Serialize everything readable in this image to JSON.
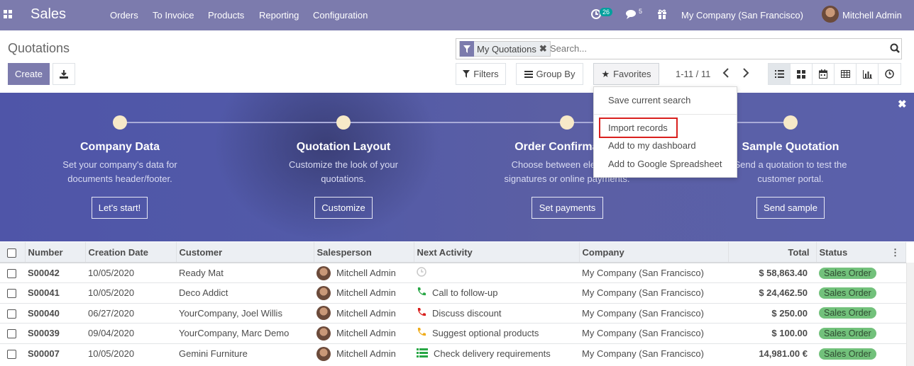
{
  "app": {
    "title": "Sales",
    "menu": [
      "Orders",
      "To Invoice",
      "Products",
      "Reporting",
      "Configuration"
    ],
    "activity_count": "26",
    "message_count": "5",
    "company": "My Company (San Francisco)",
    "user": "Mitchell Admin"
  },
  "control": {
    "breadcrumb": "Quotations",
    "create_label": "Create",
    "facet_label": "My Quotations",
    "search_placeholder": "Search...",
    "filters_label": "Filters",
    "groupby_label": "Group By",
    "favorites_label": "Favorites",
    "pager": "1-11 / 11"
  },
  "favorites_menu": {
    "items": [
      "Save current search",
      "Import records",
      "Add to my dashboard",
      "Add to Google Spreadsheet"
    ],
    "highlighted": "Import records",
    "highlight_color": "#d9201e"
  },
  "onboarding": {
    "steps": [
      {
        "title": "Company Data",
        "desc1": "Set your company's data for",
        "desc2": "documents header/footer.",
        "button": "Let's start!"
      },
      {
        "title": "Quotation Layout",
        "desc1": "Customize the look of your",
        "desc2": "quotations.",
        "button": "Customize"
      },
      {
        "title": "Order Confirmation",
        "desc1": "Choose between electronic",
        "desc2": "signatures or online payments.",
        "button": "Set payments"
      },
      {
        "title": "Sample Quotation",
        "desc1": "Send a quotation to test the",
        "desc2": "customer portal.",
        "button": "Send sample"
      }
    ]
  },
  "table": {
    "headers": [
      "Number",
      "Creation Date",
      "Customer",
      "Salesperson",
      "Next Activity",
      "Company",
      "Total",
      "Status"
    ],
    "rows": [
      {
        "number": "S00042",
        "date": "10/05/2020",
        "customer": "Ready Mat",
        "salesperson": "Mitchell Admin",
        "activity": "",
        "activity_icon": "clock-icon",
        "company": "My Company (San Francisco)",
        "total": "$ 58,863.40",
        "status": "Sales Order"
      },
      {
        "number": "S00041",
        "date": "10/05/2020",
        "customer": "Deco Addict",
        "salesperson": "Mitchell Admin",
        "activity": "Call to follow-up",
        "activity_icon": "phone-icon-green",
        "company": "My Company (San Francisco)",
        "total": "$ 24,462.50",
        "status": "Sales Order"
      },
      {
        "number": "S00040",
        "date": "06/27/2020",
        "customer": "YourCompany, Joel Willis",
        "salesperson": "Mitchell Admin",
        "activity": "Discuss discount",
        "activity_icon": "phone-icon-red",
        "company": "My Company (San Francisco)",
        "total": "$ 250.00",
        "status": "Sales Order"
      },
      {
        "number": "S00039",
        "date": "09/04/2020",
        "customer": "YourCompany, Marc Demo",
        "salesperson": "Mitchell Admin",
        "activity": "Suggest optional products",
        "activity_icon": "phone-icon-orange",
        "company": "My Company (San Francisco)",
        "total": "$ 100.00",
        "status": "Sales Order"
      },
      {
        "number": "S00007",
        "date": "10/05/2020",
        "customer": "Gemini Furniture",
        "salesperson": "Mitchell Admin",
        "activity": "Check delivery requirements",
        "activity_icon": "list-icon-green",
        "company": "My Company (San Francisco)",
        "total": "14,981.00 €",
        "status": "Sales Order"
      }
    ]
  },
  "colors": {
    "brand": "#7c7bad",
    "status_pill": "#72c17b",
    "banner": "#525aa8"
  }
}
